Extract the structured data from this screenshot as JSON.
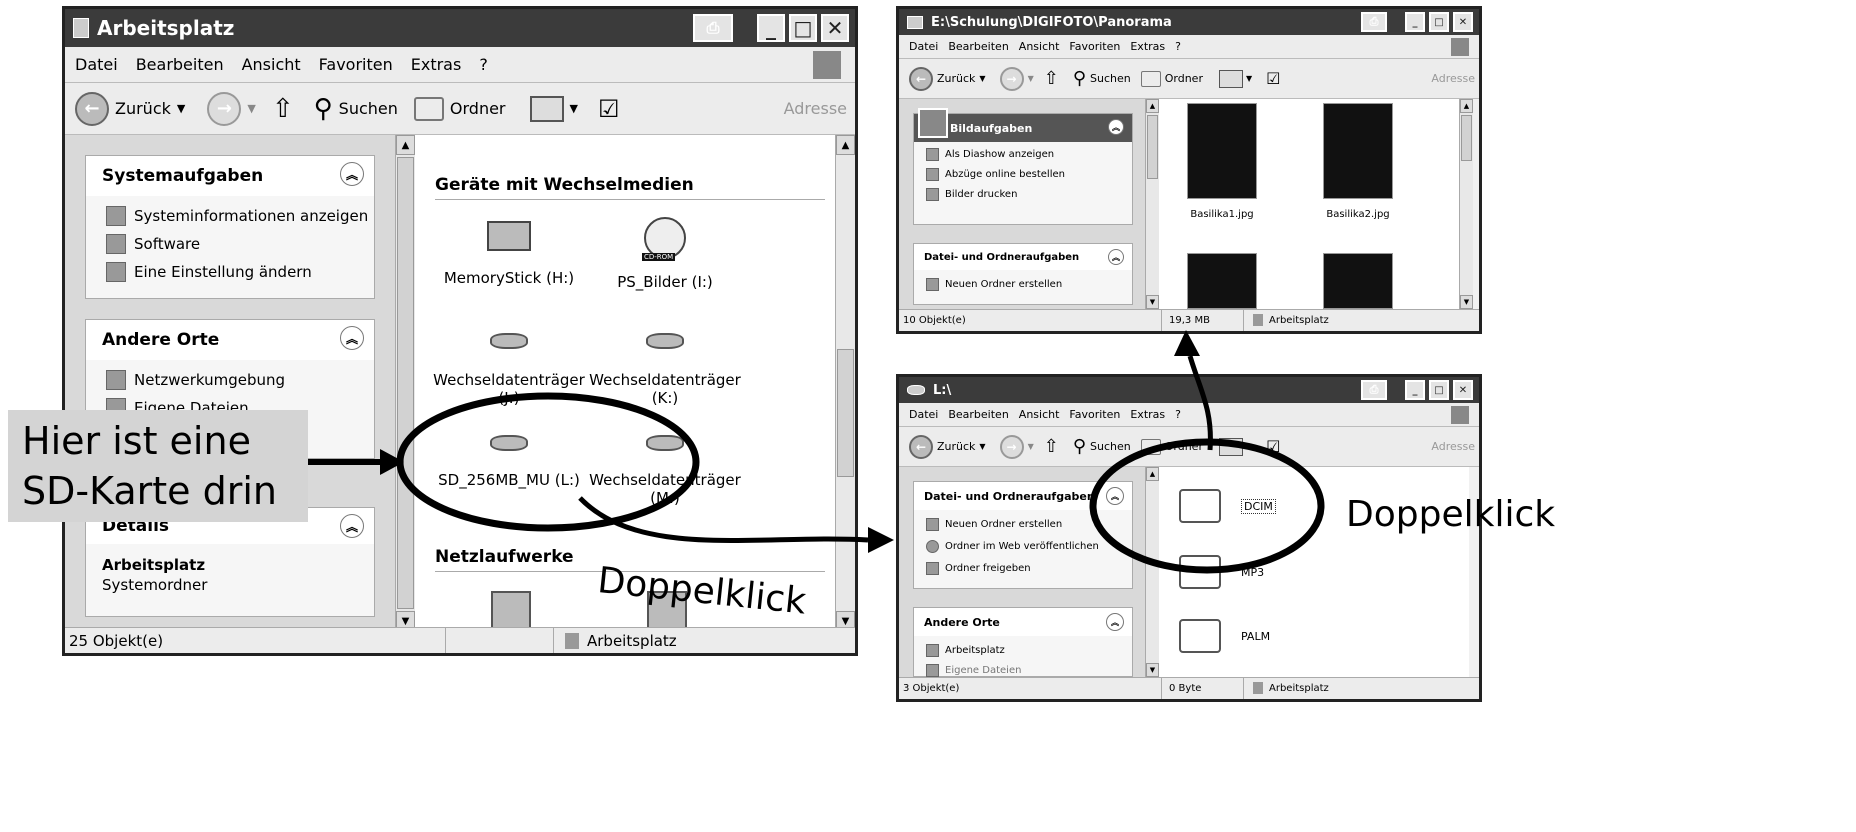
{
  "menu": [
    "Datei",
    "Bearbeiten",
    "Ansicht",
    "Favoriten",
    "Extras",
    "?"
  ],
  "toolbar": {
    "back": "Zurück",
    "search": "Suchen",
    "folders": "Ordner",
    "address": "Adresse"
  },
  "win1": {
    "title": "Arbeitsplatz",
    "tasks": {
      "title": "Systemaufgaben",
      "items": [
        "Systeminformationen anzeigen",
        "Software",
        "Eine Einstellung ändern"
      ]
    },
    "places": {
      "title": "Andere Orte",
      "items": [
        "Netzwerkumgebung",
        "Eigene Dateien"
      ]
    },
    "details": {
      "title": "Details",
      "name": "Arbeitsplatz",
      "sub": "Systemordner"
    },
    "section_removable": "Geräte mit Wechselmedien",
    "section_network": "Netzlaufwerke",
    "drives": [
      "MemoryStick (H:)",
      "PS_Bilder (I:)",
      "Wechseldatenträger (J:)",
      "Wechseldatenträger (K:)",
      "SD_256MB_MU (L:)",
      "Wechseldatenträger (M:)"
    ],
    "cdrom_label": "CD-ROM",
    "status": {
      "count": "25 Objekt(e)",
      "location": "Arbeitsplatz"
    }
  },
  "win2": {
    "title": "E:\\Schulung\\DIGIFOTO\\Panorama",
    "tasks": {
      "title": "Bildaufgaben",
      "items": [
        "Als Diashow anzeigen",
        "Abzüge online bestellen",
        "Bilder drucken"
      ]
    },
    "tasks2": {
      "title": "Datei- und Ordneraufgaben",
      "items": [
        "Neuen Ordner erstellen"
      ]
    },
    "files": [
      "Basilika1.jpg",
      "Basilika2.jpg"
    ],
    "status": {
      "count": "10 Objekt(e)",
      "size": "19,3 MB",
      "location": "Arbeitsplatz"
    }
  },
  "win3": {
    "title": "L:\\",
    "tasks": {
      "title": "Datei- und Ordneraufgaben",
      "items": [
        "Neuen Ordner erstellen",
        "Ordner im Web veröffentlichen",
        "Ordner freigeben"
      ]
    },
    "places": {
      "title": "Andere Orte",
      "items": [
        "Arbeitsplatz",
        "Eigene Dateien"
      ]
    },
    "folders": [
      "DCIM",
      "MP3",
      "PALM"
    ],
    "status": {
      "count": "3 Objekt(e)",
      "size": "0 Byte",
      "location": "Arbeitsplatz"
    }
  },
  "callout": {
    "line1": "Hier ist eine",
    "line2": "SD-Karte drin"
  },
  "annotation": "Doppelklick"
}
